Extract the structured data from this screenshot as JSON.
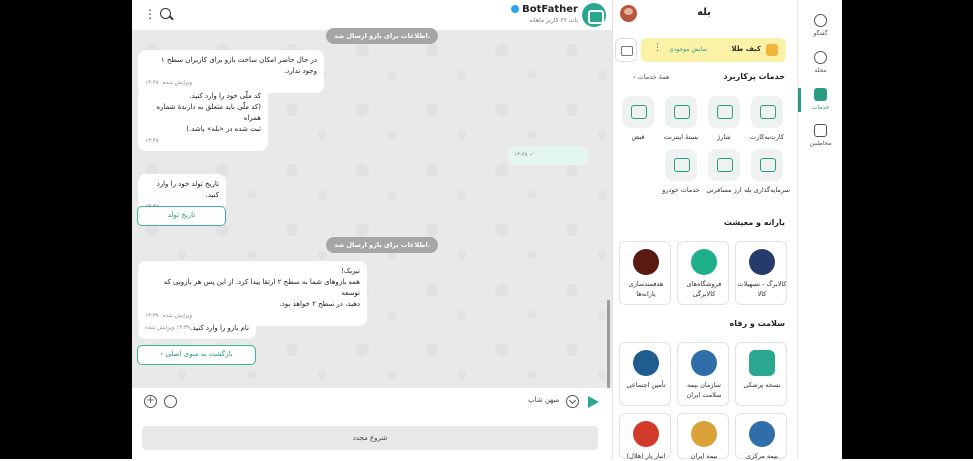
{
  "chat": {
    "bot_name": "BotFather",
    "bot_subtitle": "بات ۳۶ کاربر ماهانه",
    "messages": [
      {
        "text": "اطلاعات برای بازو ارسال شد.",
        "type": "pill"
      },
      {
        "text": "در حال حاضر امکان ساخت بازو برای کاربران سطح ۱ وجود ندارد.",
        "time": "۱۳:۳۸",
        "status": "ویرایش شده"
      },
      {
        "line1": "کد ملّی خود را وارد کنید.",
        "line2": "(کد ملّی باید متعلق به دارندهٔ شماره همراه",
        "line3": "ثبت شده در «بله» باشد.)",
        "time": "۱۳:۳۸"
      },
      {
        "text": "",
        "time": "۱۳:۳۸",
        "direction": "out"
      },
      {
        "text": "تاریخ تولد خود را وارد کنید.",
        "time": "۱۳:۳۸"
      },
      {
        "button": "تاریخ تولد"
      },
      {
        "text": "اطلاعات برای بازو ارسال شد.",
        "type": "pill"
      },
      {
        "line1": "تبریک!",
        "line2": "همه بازوهای شما به سطح ۲ ارتقا پیدا کرد. از این پس هر بازویی که توسعه",
        "line3": "دهید، در سطح ۲ خواهد بود.",
        "time": "۱۳:۳۹",
        "status": "ویرایش شده"
      },
      {
        "text": "نام بازو را وارد کنید.",
        "time": "۱۳:۳۹",
        "status": "ویرایش شده"
      },
      {
        "button": "بازگشت به منوی اصلی"
      }
    ],
    "composer_guest": "میهن شاپ",
    "restart_label": "شروع مجدد"
  },
  "services": {
    "app_title": "بله",
    "wallet_label": "کیف طلا",
    "wallet_show": "نمایش موجودی",
    "popular_title": "خدمات پرکاربرد",
    "all_services_link": "همهٔ خدمات",
    "popular": [
      {
        "label": "کارت‌به‌کارت",
        "icon": "card-transfer-icon"
      },
      {
        "label": "شارژ",
        "icon": "sim-charge-icon"
      },
      {
        "label": "بستهٔ اینترنت",
        "icon": "internet-package-icon"
      },
      {
        "label": "قبض",
        "icon": "bill-icon"
      },
      {
        "label": "سرمایه‌گذاری بله",
        "icon": "investment-icon"
      },
      {
        "label": "ارز مسافرتی",
        "icon": "travel-currency-icon"
      },
      {
        "label": "خدمات خودرو",
        "icon": "car-services-icon"
      }
    ],
    "subsidy_title": "یارانه و معیشت",
    "subsidy": [
      {
        "label": "کالابرگ - تسهیلات کالا",
        "color": "#263a6b"
      },
      {
        "label": "فروشگاه‌های کالابرگی",
        "color": "#1fae8a"
      },
      {
        "label": "هدفمندسازی یارانه‌ها",
        "color": "#5a1a14"
      }
    ],
    "health_title": "سلامت و رفاه",
    "health": [
      {
        "label": "نسخه پزشکی",
        "color": "#2aa88f"
      },
      {
        "label": "سازمان بیمه سلامت ایران",
        "color": "#2f6ea8"
      },
      {
        "label": "تأمین اجتماعی",
        "color": "#1f5c8f"
      }
    ],
    "more": [
      {
        "label": "بیمه مرکزی",
        "color": "#2f6ea8"
      },
      {
        "label": "بیمه ایران",
        "color": "#d9a33a"
      },
      {
        "label": "انبار پار (هلال)",
        "color": "#d43a2a"
      }
    ]
  },
  "nav": {
    "items": [
      {
        "label": "گفتگو",
        "icon": "chat-icon"
      },
      {
        "label": "مجله",
        "icon": "magazine-icon"
      },
      {
        "label": "خدمات",
        "icon": "services-icon",
        "active": true
      },
      {
        "label": "مخاطبین",
        "icon": "contacts-icon"
      }
    ]
  }
}
